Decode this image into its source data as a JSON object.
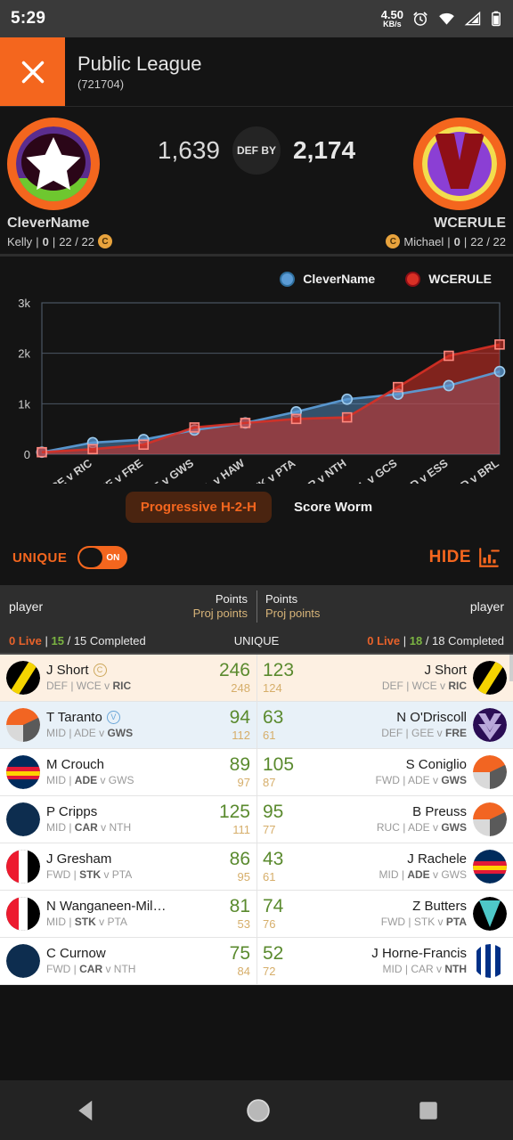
{
  "status_bar": {
    "time": "5:29",
    "net_value": "4.50",
    "net_unit": "KB/s",
    "icons": [
      "alarm-icon",
      "wifi-icon",
      "signal-icon",
      "battery-icon"
    ]
  },
  "app_bar": {
    "close_icon": "close-icon",
    "title": "Public League",
    "subtitle": "(721704)"
  },
  "scoreboard": {
    "left": {
      "team_name": "CleverName",
      "manager": "Kelly",
      "trades": "0",
      "played": "22 / 22",
      "badge": "C",
      "score": "1,639"
    },
    "right": {
      "team_name": "WCERULE",
      "manager": "Michael",
      "trades": "0",
      "played": "22 / 22",
      "badge": "C",
      "score": "2,174"
    },
    "status": "DEF BY"
  },
  "chart_data": {
    "type": "line",
    "title": "",
    "xlabel": "",
    "ylabel": "",
    "ylim": [
      0,
      3000
    ],
    "yticks": [
      "0",
      "1k",
      "2k",
      "3k"
    ],
    "ytick_values": [
      0,
      1000,
      2000,
      3000
    ],
    "grid": true,
    "legend_position": "top-right",
    "categories": [
      "WCE v RIC",
      "GEE v FRE",
      "ADE v GWS",
      "MEL v HAW",
      "STK v PTA",
      "CAR v NTH",
      "COL v GCS",
      "WBD v ESS",
      "SYD v BRL"
    ],
    "x_origin_label": "",
    "series": [
      {
        "name": "CleverName",
        "color": "#5b9bd5",
        "marker": "circle",
        "values": [
          40,
          230,
          290,
          480,
          620,
          840,
          1090,
          1190,
          1360,
          1639
        ]
      },
      {
        "name": "WCERULE",
        "color": "#d93025",
        "marker": "square",
        "values": [
          40,
          100,
          190,
          530,
          620,
          700,
          730,
          1330,
          1950,
          2174
        ]
      }
    ]
  },
  "chart_tabs": {
    "active": "Progressive H-2-H",
    "inactive": "Score Worm"
  },
  "controls": {
    "unique_label": "UNIQUE",
    "toggle_state": "ON",
    "hide_label": "HIDE",
    "hide_icon": "chart-hide-icon"
  },
  "table": {
    "header": {
      "left_player": "player",
      "left_points": "Points",
      "left_proj": "Proj points",
      "right_points": "Points",
      "right_proj": "Proj points",
      "right_player": "player"
    },
    "subheader": {
      "left_live": "0 Live",
      "left_sep": "|",
      "left_done_num": "15",
      "left_done_rest": "/ 15 Completed",
      "center": "UNIQUE",
      "right_live": "0 Live",
      "right_sep": "|",
      "right_done_num": "18",
      "right_done_rest": "/ 18 Completed"
    },
    "rows": [
      {
        "highlight": "peach",
        "left": {
          "name": "J Short",
          "badge": "C",
          "badge_type": "c",
          "pos": "DEF",
          "team": "WCE",
          "vs": "RIC",
          "bold_side": "away",
          "points": "246",
          "proj": "248",
          "crest": "richmond"
        },
        "right": {
          "name": "J Short",
          "badge": "",
          "badge_type": "",
          "pos": "DEF",
          "team": "WCE",
          "vs": "RIC",
          "bold_side": "away",
          "points": "123",
          "proj": "124",
          "crest": "richmond"
        }
      },
      {
        "highlight": "blue",
        "left": {
          "name": "T Taranto",
          "badge": "V",
          "badge_type": "v",
          "pos": "MID",
          "team": "ADE",
          "vs": "GWS",
          "bold_side": "away",
          "points": "94",
          "proj": "112",
          "crest": "gws"
        },
        "right": {
          "name": "N O'Driscoll",
          "badge": "",
          "badge_type": "",
          "pos": "DEF",
          "team": "GEE",
          "vs": "FRE",
          "bold_side": "away",
          "points": "63",
          "proj": "61",
          "crest": "fremantle"
        }
      },
      {
        "highlight": "none",
        "left": {
          "name": "M Crouch",
          "badge": "",
          "badge_type": "",
          "pos": "MID",
          "team": "ADE",
          "vs": "GWS",
          "bold_side": "home",
          "points": "89",
          "proj": "97",
          "crest": "adelaide"
        },
        "right": {
          "name": "S Coniglio",
          "badge": "",
          "badge_type": "",
          "pos": "FWD",
          "team": "ADE",
          "vs": "GWS",
          "bold_side": "away",
          "points": "105",
          "proj": "87",
          "crest": "gws"
        }
      },
      {
        "highlight": "none",
        "left": {
          "name": "P Cripps",
          "badge": "",
          "badge_type": "",
          "pos": "MID",
          "team": "CAR",
          "vs": "NTH",
          "bold_side": "home",
          "points": "125",
          "proj": "111",
          "crest": "carlton"
        },
        "right": {
          "name": "B Preuss",
          "badge": "",
          "badge_type": "",
          "pos": "RUC",
          "team": "ADE",
          "vs": "GWS",
          "bold_side": "away",
          "points": "95",
          "proj": "77",
          "crest": "gws"
        }
      },
      {
        "highlight": "none",
        "left": {
          "name": "J Gresham",
          "badge": "",
          "badge_type": "",
          "pos": "FWD",
          "team": "STK",
          "vs": "PTA",
          "bold_side": "home",
          "points": "86",
          "proj": "95",
          "crest": "stkilda"
        },
        "right": {
          "name": "J Rachele",
          "badge": "",
          "badge_type": "",
          "pos": "MID",
          "team": "ADE",
          "vs": "GWS",
          "bold_side": "home",
          "points": "43",
          "proj": "61",
          "crest": "adelaide"
        }
      },
      {
        "highlight": "none",
        "left": {
          "name": "N Wanganeen-Mil…",
          "badge": "",
          "badge_type": "",
          "pos": "MID",
          "team": "STK",
          "vs": "PTA",
          "bold_side": "home",
          "points": "81",
          "proj": "53",
          "crest": "stkilda"
        },
        "right": {
          "name": "Z Butters",
          "badge": "",
          "badge_type": "",
          "pos": "FWD",
          "team": "STK",
          "vs": "PTA",
          "bold_side": "away",
          "points": "74",
          "proj": "76",
          "crest": "portadelaide"
        }
      },
      {
        "highlight": "none",
        "left": {
          "name": "C Curnow",
          "badge": "",
          "badge_type": "",
          "pos": "FWD",
          "team": "CAR",
          "vs": "NTH",
          "bold_side": "home",
          "points": "75",
          "proj": "84",
          "crest": "carlton"
        },
        "right": {
          "name": "J Horne-Francis",
          "badge": "",
          "badge_type": "",
          "pos": "MID",
          "team": "CAR",
          "vs": "NTH",
          "bold_side": "away",
          "points": "52",
          "proj": "72",
          "crest": "northmelbourne"
        }
      }
    ]
  },
  "nav_bar": {
    "back": "back-icon",
    "home": "home-icon",
    "recent": "recent-apps-icon"
  },
  "colors": {
    "accent": "#f4661e",
    "series_a": "#5b9bd5",
    "series_b": "#d93025",
    "points_green": "#5a8a2e",
    "proj_gold": "#d6ae6a"
  }
}
